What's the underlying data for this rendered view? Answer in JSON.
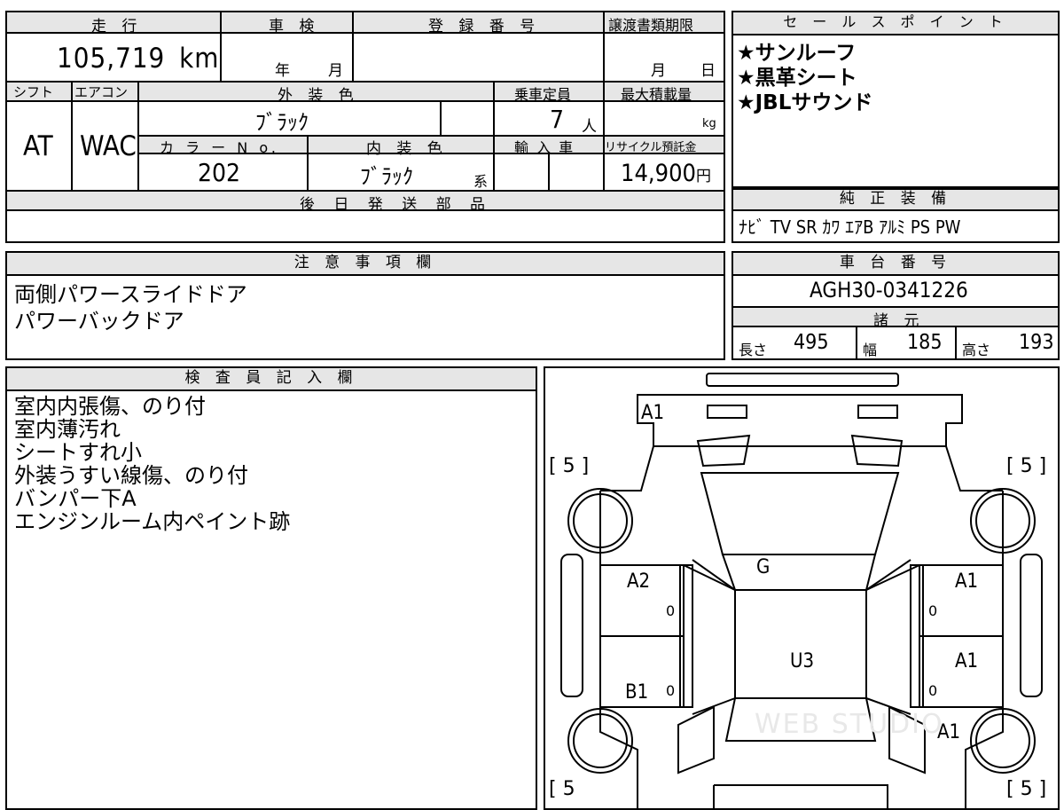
{
  "main": {
    "mileage": {
      "label": "走 行",
      "value": "105,719",
      "unit": "km"
    },
    "shaken": {
      "label": "車 検",
      "year_unit": "年",
      "month_unit": "月"
    },
    "registration": {
      "label": "登 録 番 号"
    },
    "transfer_docs": {
      "label": "譲渡書類期限",
      "month_unit": "月",
      "day_unit": "日"
    },
    "shift": {
      "label": "シフト",
      "value": "AT"
    },
    "aircon": {
      "label": "エアコン",
      "value": "WAC"
    },
    "exterior_color": {
      "label": "外 装 色",
      "value": "ﾌﾞﾗｯｸ"
    },
    "capacity": {
      "label": "乗車定員",
      "value": "7",
      "unit": "人"
    },
    "max_load": {
      "label": "最大積載量",
      "unit": "kg"
    },
    "color_no": {
      "label": "カ ラ ー N o.",
      "value": "202"
    },
    "interior_color": {
      "label": "内 装 色",
      "value": "ﾌﾞﾗｯｸ",
      "suffix": "系"
    },
    "import": {
      "label": "輸 入 車"
    },
    "recycle": {
      "label": "リサイクル預託金",
      "value": "14,900",
      "unit": "円"
    },
    "later_parts": {
      "label": "後 日 発 送 部 品"
    }
  },
  "sales_points": {
    "label": "セ ー ル ス ポ イ ン ト",
    "items": [
      "★サンルーフ",
      "★黒革シート",
      "★JBLサウンド"
    ]
  },
  "genuine_equipment": {
    "label": "純 正 装 備",
    "value": "ﾅﾋﾞ TV SR ｶﾜ ｴｱB ｱﾙﾐ PS PW"
  },
  "notes": {
    "label": "注 意 事 項 欄",
    "lines": [
      "両側パワースライドドア",
      "パワーバックドア"
    ]
  },
  "chassis": {
    "label": "車 台 番 号",
    "value": "AGH30-0341226"
  },
  "specs": {
    "label": "諸 元",
    "length_label": "長さ",
    "length": "495",
    "width_label": "幅",
    "width": "185",
    "height_label": "高さ",
    "height": "193"
  },
  "inspector": {
    "label": "検 査 員 記 入 欄",
    "lines": [
      "室内内張傷、のり付",
      "室内薄汚れ",
      "シートすれ小",
      "外装うすい線傷、のり付",
      "バンパー下A",
      "エンジンルーム内ペイント跡"
    ]
  },
  "diagram": {
    "marks": {
      "front_bumper": "A1",
      "hood": "G",
      "left_front_door": "A2",
      "right_front_door": "A1",
      "left_rear_door": "B1",
      "right_rear_door": "A1",
      "right_rear_quarter": "A1",
      "roof": "U3",
      "door_zero": "0"
    },
    "tire_tl": "[ 5 ]",
    "tire_tr": "[ 5 ]",
    "tire_bl": "[ 5",
    "tire_br": "[ 5 ]",
    "watermark": "WEB STUDIO"
  }
}
